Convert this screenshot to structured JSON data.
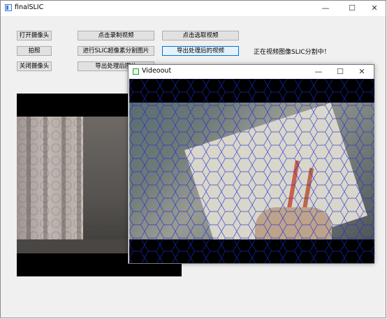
{
  "window": {
    "title": "finalSLIC",
    "minimize": "—",
    "maximize": "☐",
    "close": "✕"
  },
  "buttons": {
    "open_camera": "打开摄像头",
    "photo": "拍照",
    "close_camera": "关闭摄像头",
    "record_video": "点击录制视频",
    "slic_image": "进行SLIC超像素分割图片",
    "export_image": "导出处理后图片",
    "select_video": "点击选取视频",
    "export_video": "导出处理后的视频"
  },
  "status": "正在视频图像SLIC分割中！",
  "video_window": {
    "title": "Videoout",
    "minimize": "—",
    "maximize": "☐",
    "close": "✕"
  },
  "colors": {
    "superpixel_border": "#1a2bd9",
    "accent": "#0078d7"
  }
}
